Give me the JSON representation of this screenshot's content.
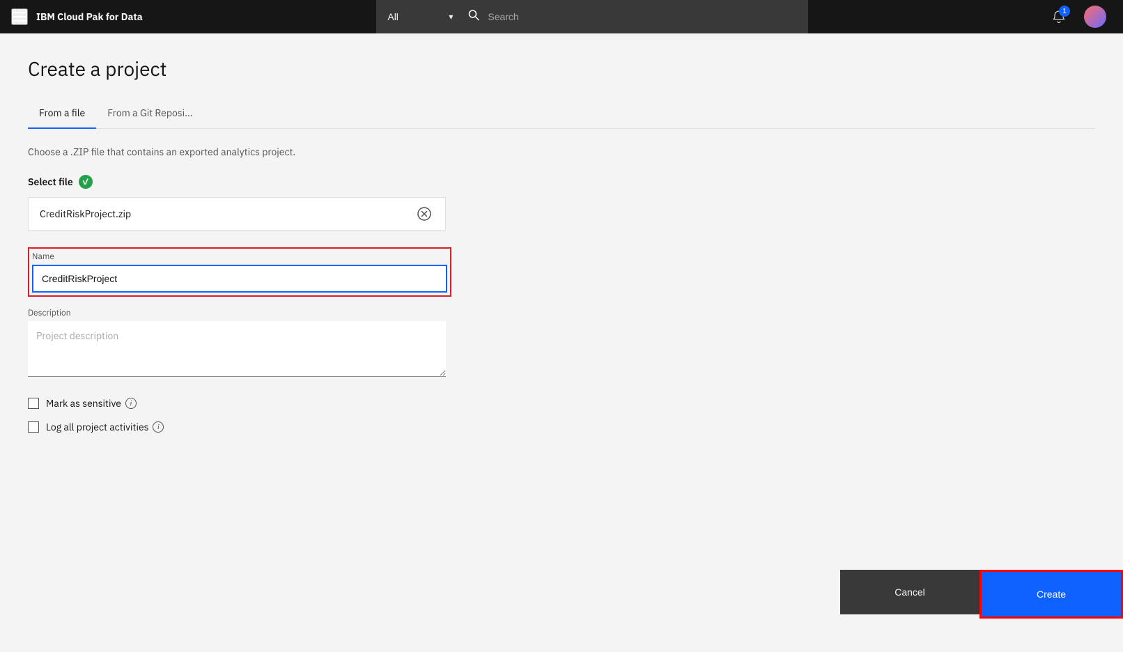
{
  "app": {
    "brand": "IBM ",
    "brand_bold": "Cloud Pak for Data"
  },
  "topnav": {
    "scope_default": "All",
    "search_placeholder": "Search",
    "notification_count": "1"
  },
  "page": {
    "title": "Create a project"
  },
  "tabs": [
    {
      "label": "From a file",
      "active": true
    },
    {
      "label": "From a Git Reposi...",
      "active": false
    }
  ],
  "form": {
    "description": "Choose a .ZIP file that contains an exported analytics project.",
    "select_file_label": "Select file",
    "file_name": "CreditRiskProject.zip",
    "name_label": "Name",
    "name_value": "CreditRiskProject",
    "description_label": "Description",
    "description_placeholder": "Project description",
    "checkbox_sensitive_label": "Mark as sensitive",
    "checkbox_log_label": "Log all project activities"
  },
  "actions": {
    "cancel_label": "Cancel",
    "create_label": "Create"
  }
}
